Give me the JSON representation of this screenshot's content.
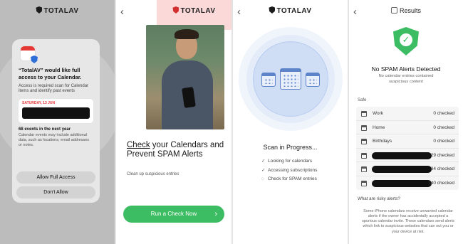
{
  "brand": {
    "name": "TOTALAV"
  },
  "permission": {
    "title": "“TotalAV” would like full access to your Calendar.",
    "body": "Access is required scan for Calendar items and identify past events",
    "date_label": "SATURDAY, 13 JUN",
    "events_count": "68 events in the next year",
    "events_note": "Calendar events may include additional data, such as locations, email addresses or notes.",
    "allow_label": "Allow Full Access",
    "deny_label": "Don't Allow"
  },
  "intro": {
    "headline_first": "Check",
    "headline_rest": " your Calendars and Prevent SPAM Alerts",
    "subtitle": "Clean up suspicious entries",
    "cta_label": "Run a Check Now",
    "cta_arrow": "›"
  },
  "scan": {
    "title": "Scan in Progress...",
    "steps": [
      {
        "label": "Looking for calendars",
        "mark": "✓"
      },
      {
        "label": "Accessing subscriptions",
        "mark": "✓"
      },
      {
        "label": "Check for SPAM entries",
        "mark": "◌"
      }
    ]
  },
  "results": {
    "title": "Results",
    "headline": "No SPAM Alerts Detected",
    "subline": "No calendar entries contained suspicious content",
    "safe_label": "Safe",
    "rows": [
      {
        "name": "Work",
        "count": "0 checked"
      },
      {
        "name": "Home",
        "count": "0 checked"
      },
      {
        "name": "Birthdays",
        "count": "0 checked"
      },
      {
        "name": "",
        "count": "29 checked"
      },
      {
        "name": "",
        "count": "84 checked"
      },
      {
        "name": "",
        "count": "140 checked"
      }
    ],
    "risk_heading": "What are risky alerts?",
    "risk_body": "Some iPhone calendars receive unwanted calendar alerts if the owner has accidentally accepted a spurious calendar invite. These calendars send alerts which link to suspicious websites that can out you or your device at risk."
  },
  "icons": {
    "back": "chevron-left-icon",
    "brand": "totalav-shield-icon",
    "check": "checkmark-icon"
  },
  "colors": {
    "accent_green": "#3dbd63",
    "brand_red": "#d32f2f",
    "scan_blue": "#5d84c9"
  }
}
